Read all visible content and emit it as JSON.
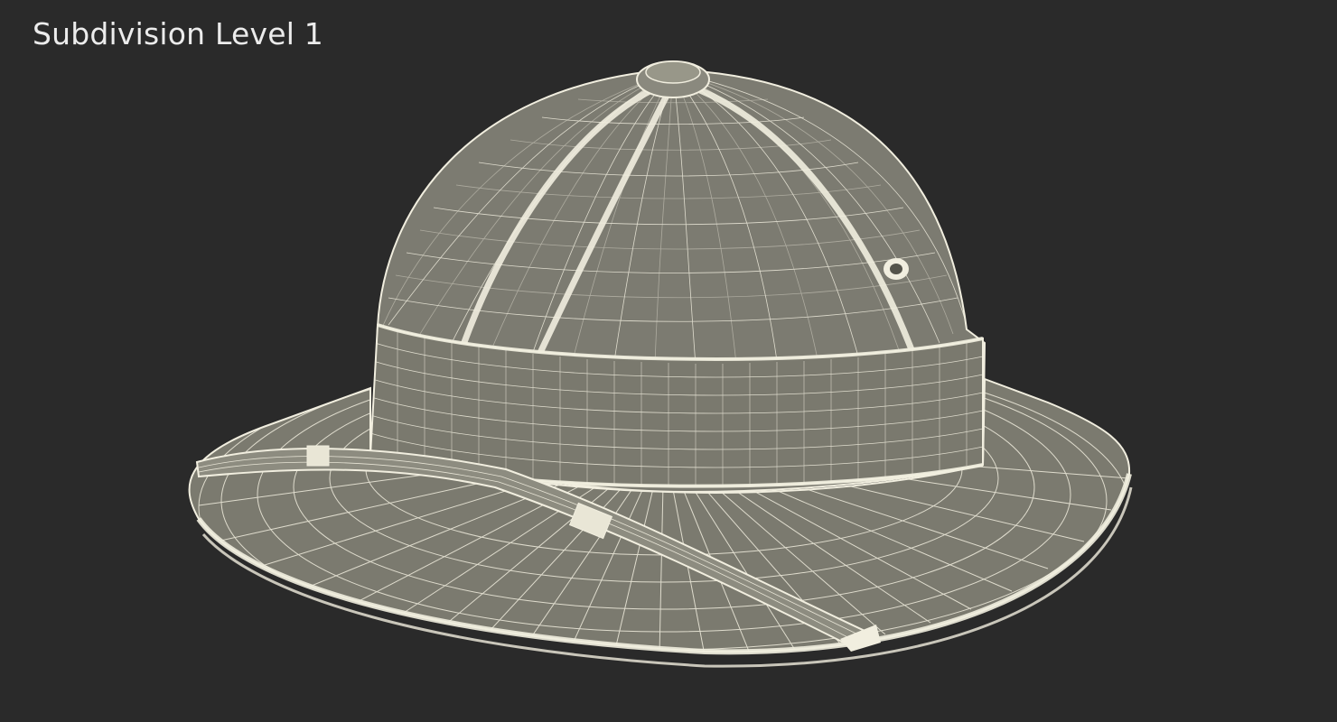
{
  "viewport": {
    "label": "Subdivision Level 1",
    "background_color": "#2a2a2a",
    "model": {
      "subject": "pith helmet wireframe",
      "fill_color": "#7d7c70",
      "wire_color": "#f1eedf"
    }
  }
}
